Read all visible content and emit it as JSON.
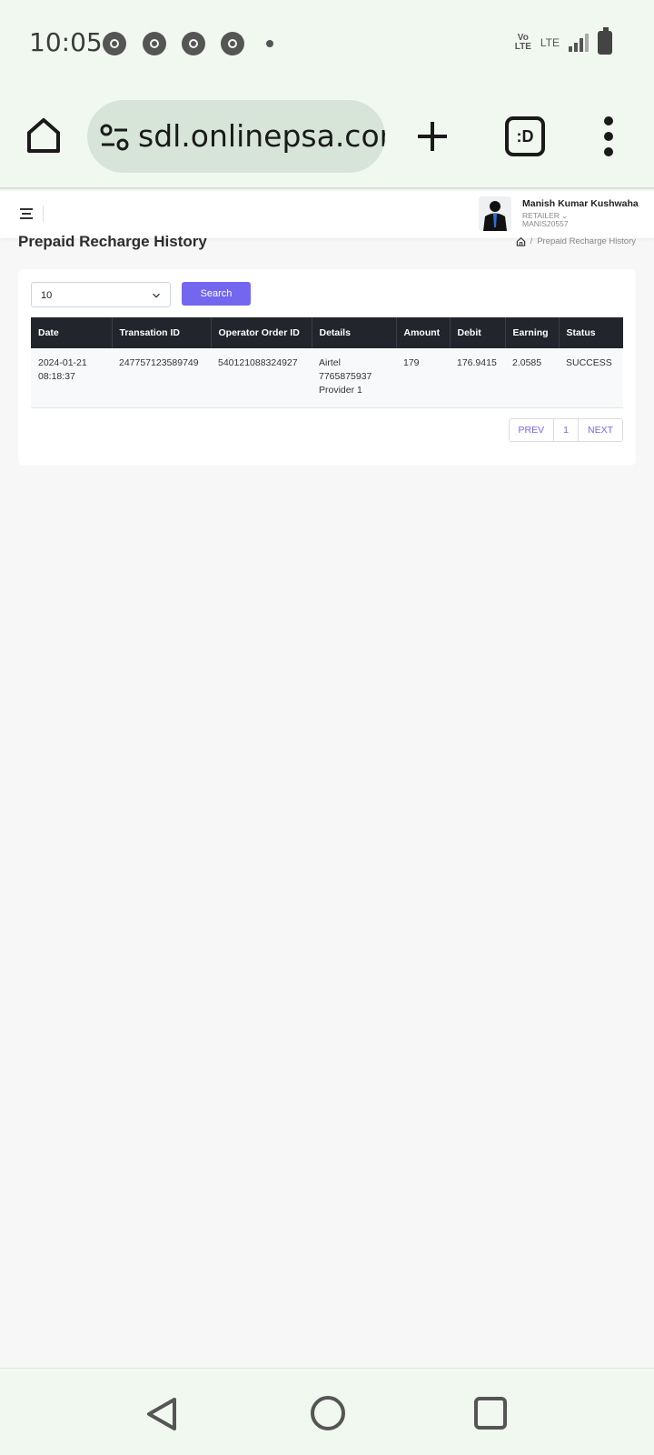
{
  "status_bar": {
    "time": "10:05",
    "volte": "Vo\nLTE",
    "network": "LTE",
    "notification_icons": [
      "chrome-icon",
      "chrome-icon",
      "chrome-icon",
      "chrome-icon"
    ]
  },
  "browser": {
    "url": "sdl.onlinepsa.com",
    "tabs_label": ":D"
  },
  "header": {
    "user_name": "Manish Kumar Kushwaha",
    "user_role": "RETAILER ⌄",
    "user_id": "MANIS20557"
  },
  "page": {
    "title": "Prepaid Recharge History",
    "breadcrumb_separator": "/",
    "breadcrumb_current": "Prepaid Recharge History"
  },
  "filters": {
    "page_size": "10",
    "search_label": "Search"
  },
  "table": {
    "columns": [
      "Date",
      "Transation ID",
      "Operator Order ID",
      "Details",
      "Amount",
      "Debit",
      "Earning",
      "Status"
    ],
    "rows": [
      {
        "date": "2024-01-21",
        "time": "08:18:37",
        "transaction_id": "247757123589749",
        "operator_order_id": "540121088324927",
        "details_operator": "Airtel",
        "details_number": "7765875937",
        "details_provider": "Provider 1",
        "amount": "179",
        "debit": "176.9415",
        "earning": "2.0585",
        "status": "SUCCESS"
      }
    ]
  },
  "pagination": {
    "prev": "PREV",
    "page": "1",
    "next": "NEXT"
  },
  "colors": {
    "accent": "#7367f0",
    "table_header": "#22252b",
    "chrome_bg": "#f1f8f0"
  }
}
